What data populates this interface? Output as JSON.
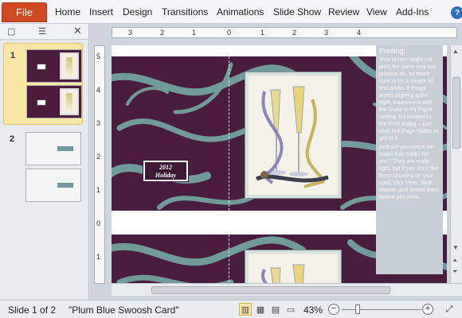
{
  "ribbon": {
    "file_label": "File",
    "tabs": [
      "Home",
      "Insert",
      "Design",
      "Transitions",
      "Animations",
      "Slide Show",
      "Review",
      "View",
      "Add-Ins"
    ],
    "help_icon": "help-icon"
  },
  "thumbnails": [
    {
      "number": "1",
      "selected": true
    },
    {
      "number": "2",
      "selected": false
    }
  ],
  "ruler": {
    "horizontal": [
      "3",
      "2",
      "1",
      "0",
      "1",
      "2",
      "3",
      "4"
    ],
    "vertical": [
      "5",
      "4",
      "3",
      "2",
      "1",
      "0",
      "1"
    ]
  },
  "slide": {
    "badge_line1": "2012",
    "badge_line2": "Holiday"
  },
  "notes": {
    "title": "Printing:",
    "paragraph1": "Your printer might not print the same way our printers do, so make sure to try a couple of test prints. If things aren't aligning quite right, experiment with the Scale to Fit Paper setting. It's located in the Print dialog – just click Full Page Slides to get to it.",
    "paragraph2": "And did you notice we made fold marks for you? They are really light, but if you don't like them showing on your card, click View, Slide Master, and delete them before you print."
  },
  "status": {
    "slide_info": "Slide 1 of 2",
    "theme": "\"Plum Blue Swoosh Card\"",
    "zoom": "43%"
  },
  "colors": {
    "plum": "#4a1d3e",
    "swoosh": "#6f9c9a",
    "file_tab": "#cf4a20"
  }
}
